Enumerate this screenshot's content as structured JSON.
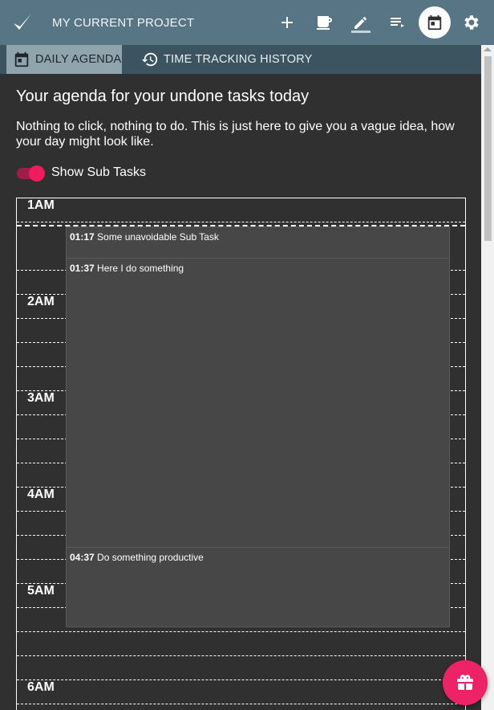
{
  "header": {
    "project_title": "MY CURRENT PROJECT",
    "icons": [
      "check-logo-icon",
      "add-icon",
      "coffee-icon",
      "edit-icon",
      "playlist-icon",
      "calendar-icon",
      "settings-icon"
    ]
  },
  "tabs": [
    {
      "label": "DAILY AGENDA",
      "icon": "calendar-icon",
      "active": true
    },
    {
      "label": "TIME TRACKING HISTORY",
      "icon": "history-icon",
      "active": false
    }
  ],
  "main": {
    "heading": "Your agenda for your undone tasks today",
    "intro": "Nothing to click, nothing to do. This is just here to give you a vague idea, how your day might look like.",
    "toggle_label": "Show Sub Tasks",
    "show_sub_tasks": true
  },
  "agenda": {
    "hours": [
      "1AM",
      "2AM",
      "3AM",
      "4AM",
      "5AM",
      "6AM"
    ],
    "tasks": [
      {
        "time": "01:17",
        "title": "Some unavoidable Sub Task"
      },
      {
        "time": "01:37",
        "title": "Here I do something"
      },
      {
        "time": "04:37",
        "title": "Do something productive"
      }
    ]
  },
  "colors": {
    "topbar": "#577584",
    "tabbar": "#3c5360",
    "active_tab": "#90a4ae",
    "accent": "#ee2266",
    "background": "#303030",
    "task_block": "#474747"
  }
}
